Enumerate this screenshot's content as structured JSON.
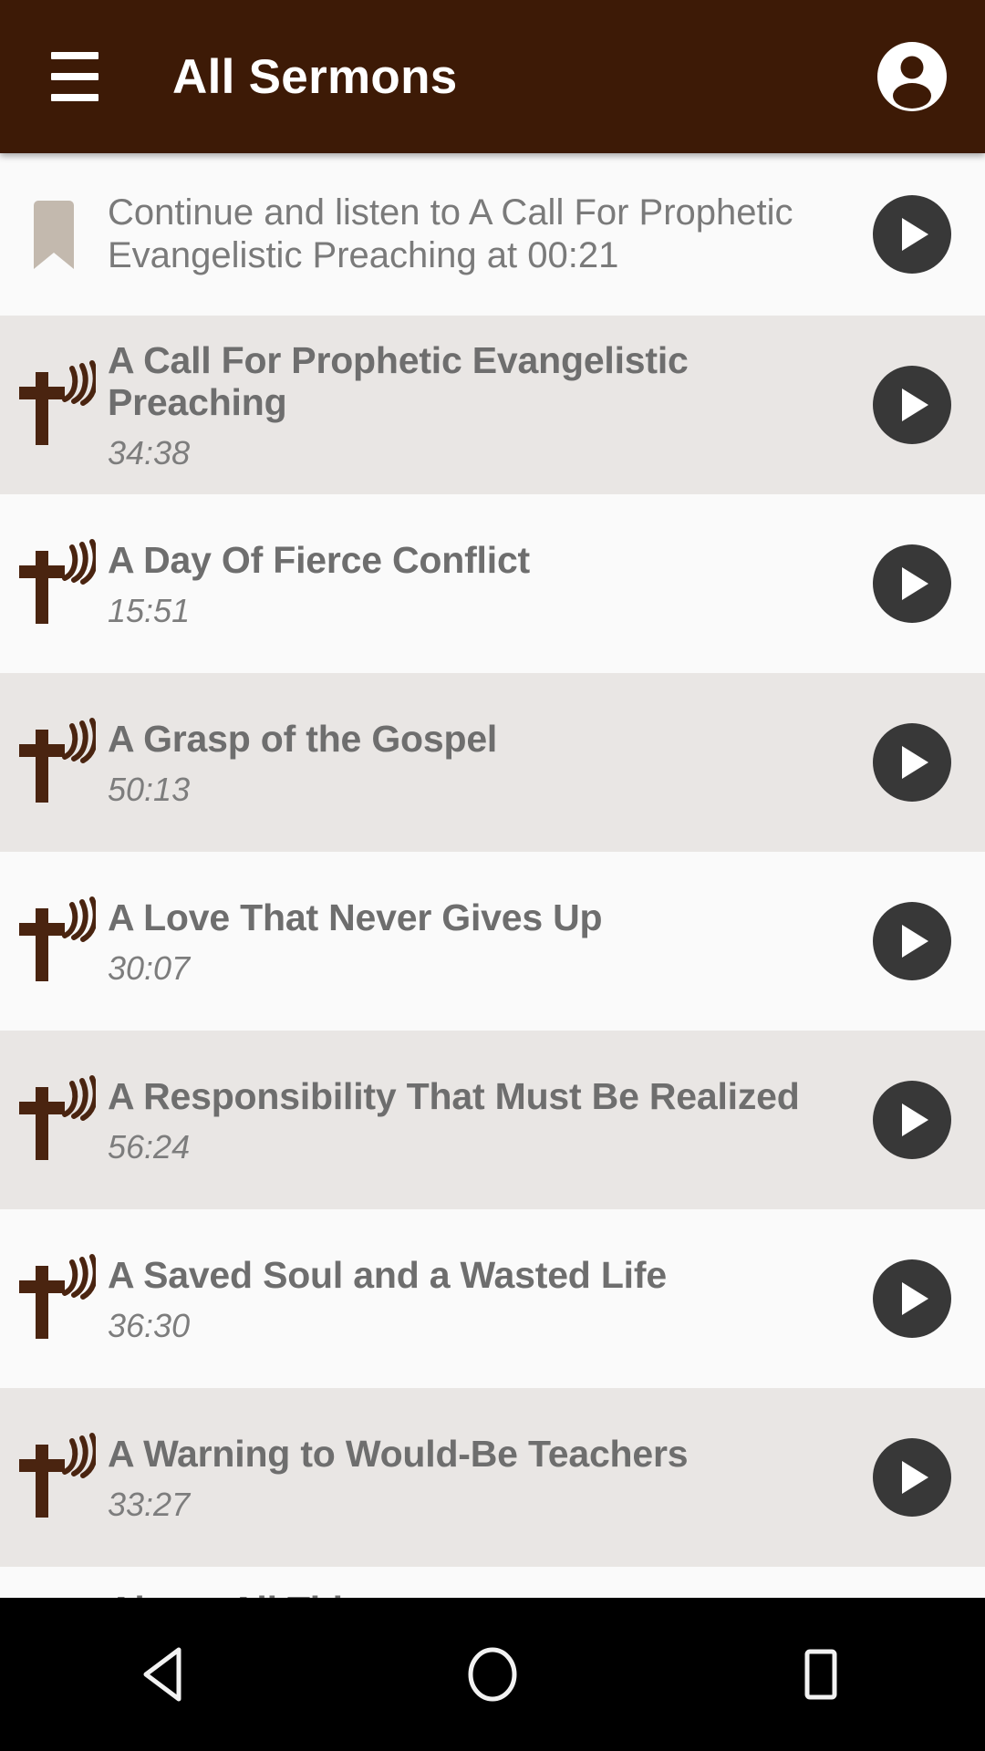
{
  "appbar": {
    "title": "All Sermons",
    "menu_icon": "hamburger-menu-icon",
    "account_icon": "account-circle-icon",
    "background_color": "#3d1a06",
    "text_color": "#ffffff"
  },
  "continue_item": {
    "icon": "bookmark-icon",
    "icon_color": "#c3b9ae",
    "text": "Continue and listen to A Call For Prophetic Evangelistic Preaching at 00:21",
    "resume_time": "00:21",
    "sermon_reference": "A Call For Prophetic Evangelistic Preaching",
    "play_icon": "play-icon"
  },
  "list": {
    "row_icon": "cross-with-soundwaves-icon",
    "row_icon_color": "#4a2410",
    "play_icon": "play-icon",
    "play_button_color": "#383838",
    "items": [
      {
        "title": "A Call For Prophetic Evangelistic Preaching",
        "duration": "34:38"
      },
      {
        "title": "A Day Of Fierce Conflict",
        "duration": "15:51"
      },
      {
        "title": "A Grasp of the Gospel",
        "duration": "50:13"
      },
      {
        "title": "A Love That Never Gives Up",
        "duration": "30:07"
      },
      {
        "title": "A Responsibility That Must Be Realized",
        "duration": "56:24"
      },
      {
        "title": "A Saved Soul and a Wasted Life",
        "duration": "36:30"
      },
      {
        "title": "A Warning to Would-Be Teachers",
        "duration": "33:27"
      },
      {
        "title": "Above All Things",
        "duration": ""
      }
    ]
  },
  "navbar": {
    "back_label": "back-icon",
    "home_label": "home-icon",
    "recents_label": "recents-icon",
    "background_color": "#000000"
  }
}
